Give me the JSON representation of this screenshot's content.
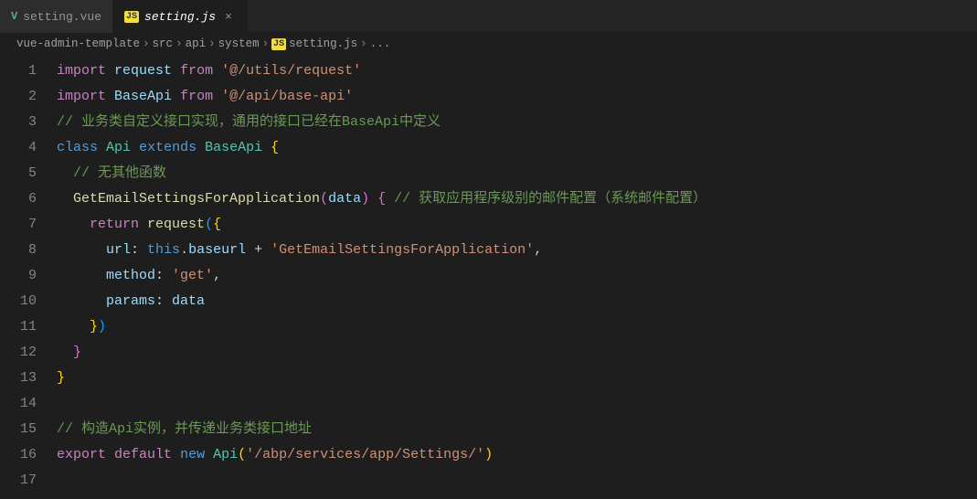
{
  "tabs": [
    {
      "icon": "V",
      "label": "setting.vue",
      "active": false
    },
    {
      "icon": "JS",
      "label": "setting.js",
      "active": true
    }
  ],
  "breadcrumbs": [
    "vue-admin-template",
    "src",
    "api",
    "system",
    "setting.js",
    "..."
  ],
  "breadcrumb_file_icon": "JS",
  "code_lines": [
    {
      "n": 1,
      "tokens": [
        [
          "tok-keyword",
          "import"
        ],
        [
          "tok-plain",
          " "
        ],
        [
          "tok-var",
          "request"
        ],
        [
          "tok-plain",
          " "
        ],
        [
          "tok-keyword",
          "from"
        ],
        [
          "tok-plain",
          " "
        ],
        [
          "tok-string",
          "'@/utils/request'"
        ]
      ]
    },
    {
      "n": 2,
      "tokens": [
        [
          "tok-keyword",
          "import"
        ],
        [
          "tok-plain",
          " "
        ],
        [
          "tok-var",
          "BaseApi"
        ],
        [
          "tok-plain",
          " "
        ],
        [
          "tok-keyword",
          "from"
        ],
        [
          "tok-plain",
          " "
        ],
        [
          "tok-string",
          "'@/api/base-api'"
        ]
      ]
    },
    {
      "n": 3,
      "tokens": [
        [
          "tok-comment",
          "// 业务类自定义接口实现，通用的接口已经在BaseApi中定义"
        ]
      ]
    },
    {
      "n": 4,
      "tokens": [
        [
          "tok-blue",
          "class"
        ],
        [
          "tok-plain",
          " "
        ],
        [
          "tok-type",
          "Api"
        ],
        [
          "tok-plain",
          " "
        ],
        [
          "tok-blue",
          "extends"
        ],
        [
          "tok-plain",
          " "
        ],
        [
          "tok-type",
          "BaseApi"
        ],
        [
          "tok-plain",
          " "
        ],
        [
          "tok-brace1",
          "{"
        ]
      ]
    },
    {
      "n": 5,
      "tokens": [
        [
          "tok-plain",
          "  "
        ],
        [
          "tok-comment",
          "// 无其他函数"
        ]
      ]
    },
    {
      "n": 6,
      "tokens": [
        [
          "tok-plain",
          "  "
        ],
        [
          "tok-func",
          "GetEmailSettingsForApplication"
        ],
        [
          "tok-brace2",
          "("
        ],
        [
          "tok-var",
          "data"
        ],
        [
          "tok-brace2",
          ")"
        ],
        [
          "tok-plain",
          " "
        ],
        [
          "tok-brace2",
          "{"
        ],
        [
          "tok-plain",
          " "
        ],
        [
          "tok-comment",
          "// 获取应用程序级别的邮件配置（系统邮件配置）"
        ]
      ]
    },
    {
      "n": 7,
      "tokens": [
        [
          "tok-plain",
          "    "
        ],
        [
          "tok-keyword",
          "return"
        ],
        [
          "tok-plain",
          " "
        ],
        [
          "tok-func",
          "request"
        ],
        [
          "tok-brace3",
          "("
        ],
        [
          "tok-brace1",
          "{"
        ]
      ]
    },
    {
      "n": 8,
      "tokens": [
        [
          "tok-plain",
          "      "
        ],
        [
          "tok-var",
          "url"
        ],
        [
          "tok-plain",
          ": "
        ],
        [
          "tok-blue",
          "this"
        ],
        [
          "tok-plain",
          "."
        ],
        [
          "tok-var",
          "baseurl"
        ],
        [
          "tok-plain",
          " "
        ],
        [
          "tok-op",
          "+"
        ],
        [
          "tok-plain",
          " "
        ],
        [
          "tok-string",
          "'GetEmailSettingsForApplication'"
        ],
        [
          "tok-plain",
          ","
        ]
      ]
    },
    {
      "n": 9,
      "tokens": [
        [
          "tok-plain",
          "      "
        ],
        [
          "tok-var",
          "method"
        ],
        [
          "tok-plain",
          ": "
        ],
        [
          "tok-string",
          "'get'"
        ],
        [
          "tok-plain",
          ","
        ]
      ]
    },
    {
      "n": 10,
      "tokens": [
        [
          "tok-plain",
          "      "
        ],
        [
          "tok-var",
          "params"
        ],
        [
          "tok-plain",
          ": "
        ],
        [
          "tok-var",
          "data"
        ]
      ]
    },
    {
      "n": 11,
      "tokens": [
        [
          "tok-plain",
          "    "
        ],
        [
          "tok-brace1",
          "}"
        ],
        [
          "tok-brace3",
          ")"
        ]
      ]
    },
    {
      "n": 12,
      "tokens": [
        [
          "tok-plain",
          "  "
        ],
        [
          "tok-brace2",
          "}"
        ]
      ]
    },
    {
      "n": 13,
      "tokens": [
        [
          "tok-brace1",
          "}"
        ]
      ]
    },
    {
      "n": 14,
      "tokens": [
        [
          "tok-plain",
          ""
        ]
      ]
    },
    {
      "n": 15,
      "tokens": [
        [
          "tok-comment",
          "// 构造Api实例，并传递业务类接口地址"
        ]
      ]
    },
    {
      "n": 16,
      "tokens": [
        [
          "tok-keyword",
          "export"
        ],
        [
          "tok-plain",
          " "
        ],
        [
          "tok-keyword",
          "default"
        ],
        [
          "tok-plain",
          " "
        ],
        [
          "tok-blue",
          "new"
        ],
        [
          "tok-plain",
          " "
        ],
        [
          "tok-type",
          "Api"
        ],
        [
          "tok-brace1",
          "("
        ],
        [
          "tok-string",
          "'/abp/services/app/Settings/'"
        ],
        [
          "tok-brace1",
          ")"
        ]
      ]
    },
    {
      "n": 17,
      "tokens": [
        [
          "tok-plain",
          ""
        ]
      ]
    }
  ]
}
